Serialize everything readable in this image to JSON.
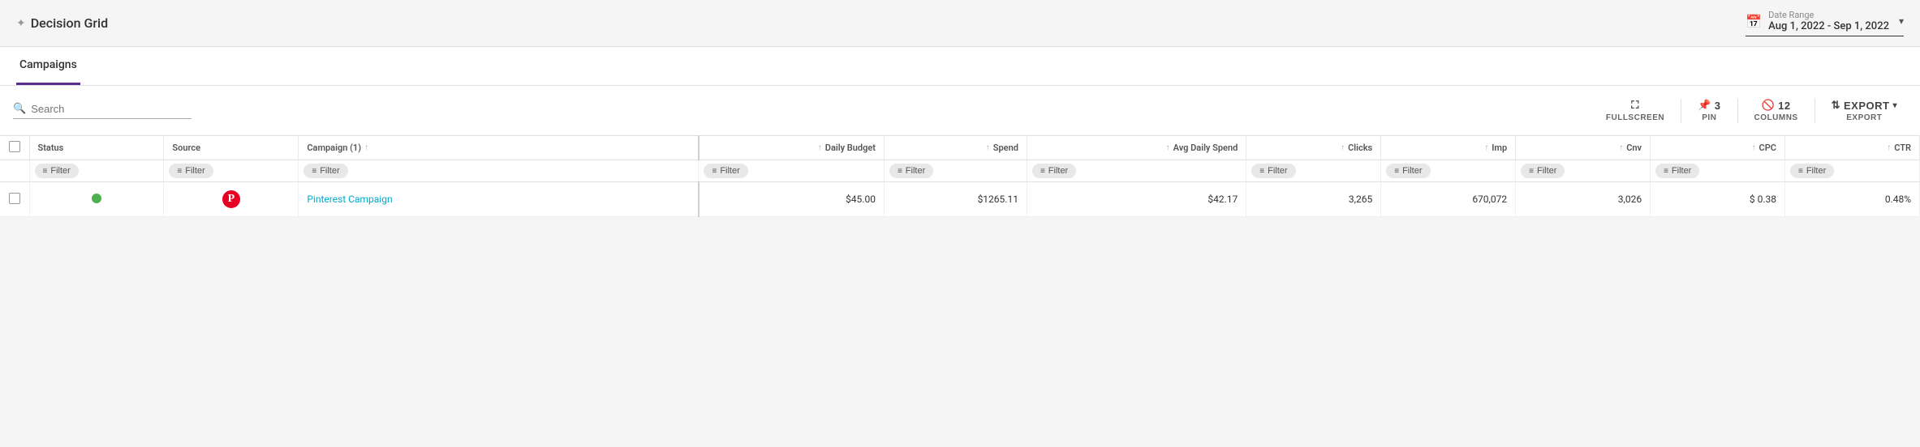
{
  "app": {
    "title": "Decision Grid",
    "sparkle": "✦"
  },
  "dateRange": {
    "label": "Date Range",
    "value": "Aug 1, 2022 - Sep 1, 2022"
  },
  "tabs": [
    {
      "id": "campaigns",
      "label": "Campaigns",
      "active": true
    }
  ],
  "search": {
    "placeholder": "Search"
  },
  "toolbar": {
    "fullscreen_icon": "⛶",
    "fullscreen_label": "FULLSCREEN",
    "pin_count": "3",
    "pin_label": "PIN",
    "columns_count": "12",
    "columns_label": "COLUMNS",
    "export_label": "EXPORT"
  },
  "columns": [
    {
      "id": "status",
      "label": "Status",
      "numeric": false
    },
    {
      "id": "source",
      "label": "Source",
      "numeric": false
    },
    {
      "id": "campaign",
      "label": "Campaign (1)",
      "numeric": false,
      "sorted": true
    },
    {
      "id": "daily_budget",
      "label": "Daily Budget",
      "numeric": true
    },
    {
      "id": "spend",
      "label": "Spend",
      "numeric": true
    },
    {
      "id": "avg_daily_spend",
      "label": "Avg Daily Spend",
      "numeric": true
    },
    {
      "id": "clicks",
      "label": "Clicks",
      "numeric": true
    },
    {
      "id": "imp",
      "label": "Imp",
      "numeric": true
    },
    {
      "id": "cnv",
      "label": "Cnv",
      "numeric": true
    },
    {
      "id": "cpc",
      "label": "CPC",
      "numeric": true
    },
    {
      "id": "ctr",
      "label": "CTR",
      "numeric": true
    }
  ],
  "filter_label": "Filter",
  "rows": [
    {
      "status": "active",
      "source": "pinterest",
      "campaign": "Pinterest Campaign",
      "daily_budget": "$45.00",
      "spend": "$1265.11",
      "avg_daily_spend": "$42.17",
      "clicks": "3,265",
      "imp": "670,072",
      "cnv": "3,026",
      "cpc": "$ 0.38",
      "ctr": "0.48%"
    }
  ]
}
